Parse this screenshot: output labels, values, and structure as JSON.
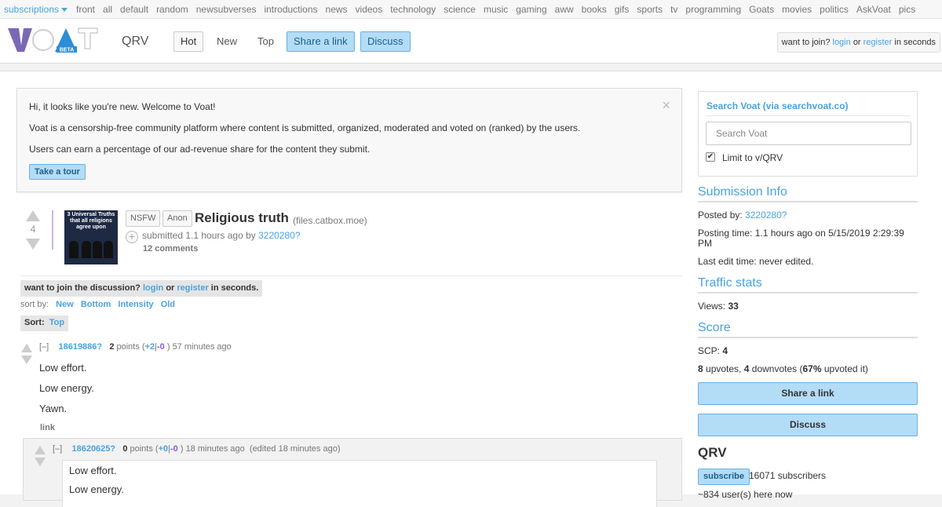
{
  "topnav": {
    "subscriptions": "subscriptions",
    "items": [
      "front",
      "all",
      "default",
      "random",
      "newsubverses",
      "introductions",
      "news",
      "videos",
      "technology",
      "science",
      "music",
      "gaming",
      "aww",
      "books",
      "gifs",
      "sports",
      "tv",
      "programming",
      "Goats",
      "movies",
      "politics",
      "AskVoat",
      "pics"
    ]
  },
  "header": {
    "logo_text": "VOAT",
    "logo_badge": "BETA",
    "subverse": "QRV",
    "tabs": {
      "hot": "Hot",
      "new": "New",
      "top": "Top",
      "share": "Share a link",
      "discuss": "Discuss"
    },
    "join": {
      "prefix": "want to join?",
      "login": "login",
      "or": "or",
      "register": "register",
      "suffix": "in seconds"
    }
  },
  "welcome": {
    "line1": "Hi, it looks like you're new. Welcome to Voat!",
    "line2": "Voat is a censorship-free community platform where content is submitted, organized, moderated and voted on (ranked) by the users.",
    "line3": "Users can earn a percentage of our ad-revenue share for the content they submit.",
    "tour": "Take a tour",
    "close": "×"
  },
  "submission": {
    "score": "4",
    "thumb_caption": "3 Universal Truths that all religions agree upon",
    "tags": [
      "NSFW",
      "Anon"
    ],
    "title": "Religious truth",
    "domain": "(files.catbox.moe)",
    "expando": "+",
    "submitted": "submitted 1.1 hours ago by",
    "author": "3220280?",
    "comments": "12 comments"
  },
  "discussion": {
    "join_prefix": "want to join the discussion?",
    "login": "login",
    "or": "or",
    "register": "register",
    "suffix": "in seconds.",
    "sort_label": "sort by:",
    "sort_options": [
      "New",
      "Bottom",
      "Intensity",
      "Old"
    ],
    "sort_current_label": "Sort:",
    "sort_current": "Top"
  },
  "comments": [
    {
      "collapse": "[–]",
      "id": "18619886?",
      "points": "2",
      "points_label": "points (",
      "up": "+2",
      "sep": "|",
      "down": "-0",
      "close": ")",
      "age": "57 minutes ago",
      "lines": [
        "Low effort.",
        "Low energy.",
        "Yawn."
      ],
      "link": "link"
    },
    {
      "collapse": "[–]",
      "id": "18620625?",
      "points": "0",
      "points_label": "points (",
      "up": "+0",
      "sep": "|",
      "down": "-0",
      "close": ")",
      "age": "18 minutes ago",
      "edited": "(edited 18 minutes ago)",
      "quote": [
        "Low effort.",
        "Low energy."
      ]
    }
  ],
  "sidebar": {
    "search_title": "Search Voat (via searchvoat.co)",
    "search_placeholder": "Search Voat",
    "limit_label": "Limit to v/QRV",
    "submission_info": "Submission Info",
    "posted_by_label": "Posted by:",
    "posted_by": "3220280?",
    "posting_time": "Posting time: 1.1 hours ago on 5/15/2019 2:29:39 PM",
    "last_edit": "Last edit time: never edited.",
    "traffic": "Traffic stats",
    "views_label": "Views:",
    "views": "33",
    "score_title": "Score",
    "scp_label": "SCP:",
    "scp": "4",
    "upvotes": "8",
    "upvotes_label": "upvotes,",
    "downvotes": "4",
    "downvotes_label": "downvotes (",
    "pct": "67%",
    "pct_label": "upvoted it)",
    "share": "Share a link",
    "discuss": "Discuss",
    "sub_name": "QRV",
    "subscribe": "subscribe",
    "subscribers": "16071 subscribers",
    "online": "~834 user(s) here now"
  },
  "colors": {
    "accent": "#4aa3df",
    "button_bg": "#b3dcf7",
    "downvote": "#8b5cd6",
    "logo_purple": "#7b68b5",
    "logo_blue": "#2c8ed6"
  }
}
